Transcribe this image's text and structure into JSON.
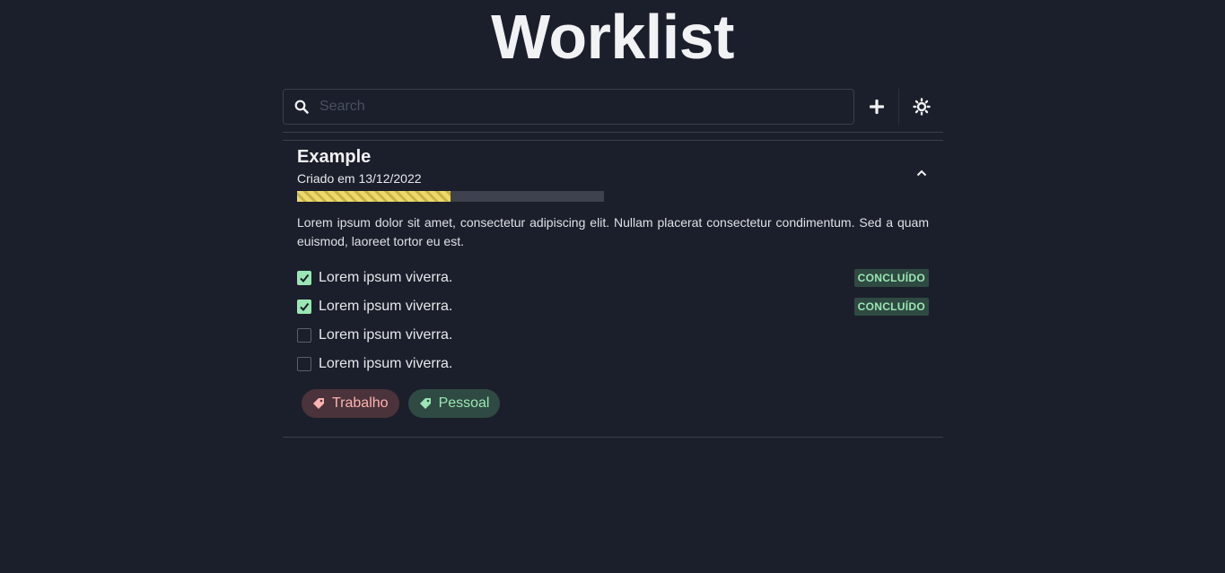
{
  "app": {
    "title": "Worklist"
  },
  "toolbar": {
    "search_placeholder": "Search",
    "search_value": "",
    "add_icon": "plus-icon",
    "theme_icon": "sun-icon"
  },
  "colors": {
    "background": "#1b1f2b",
    "progress": "#ecd96a",
    "done_badge_bg": "#2f4a42",
    "done_badge_text": "#9ae6b4",
    "tag_work_text": "#feb2b2",
    "tag_personal_text": "#9ae6b4"
  },
  "worklist": {
    "title": "Example",
    "created": "Criado em 13/12/2022",
    "progress": 0.5,
    "collapse_icon": "chevron-up-icon",
    "description": "Lorem ipsum dolor sit amet, consectetur adipiscing elit. Nullam placerat consectetur condimentum. Sed a quam euismod, laoreet tortor eu est.",
    "tasks": [
      {
        "label": "Lorem ipsum viverra.",
        "done": true,
        "status": "CONCLUÍDO"
      },
      {
        "label": "Lorem ipsum viverra.",
        "done": true,
        "status": "CONCLUÍDO"
      },
      {
        "label": "Lorem ipsum viverra.",
        "done": false,
        "status": ""
      },
      {
        "label": "Lorem ipsum viverra.",
        "done": false,
        "status": ""
      }
    ],
    "tags": [
      {
        "label": "Trabalho",
        "icon": "tag-icon"
      },
      {
        "label": "Pessoal",
        "icon": "tag-icon"
      }
    ]
  }
}
